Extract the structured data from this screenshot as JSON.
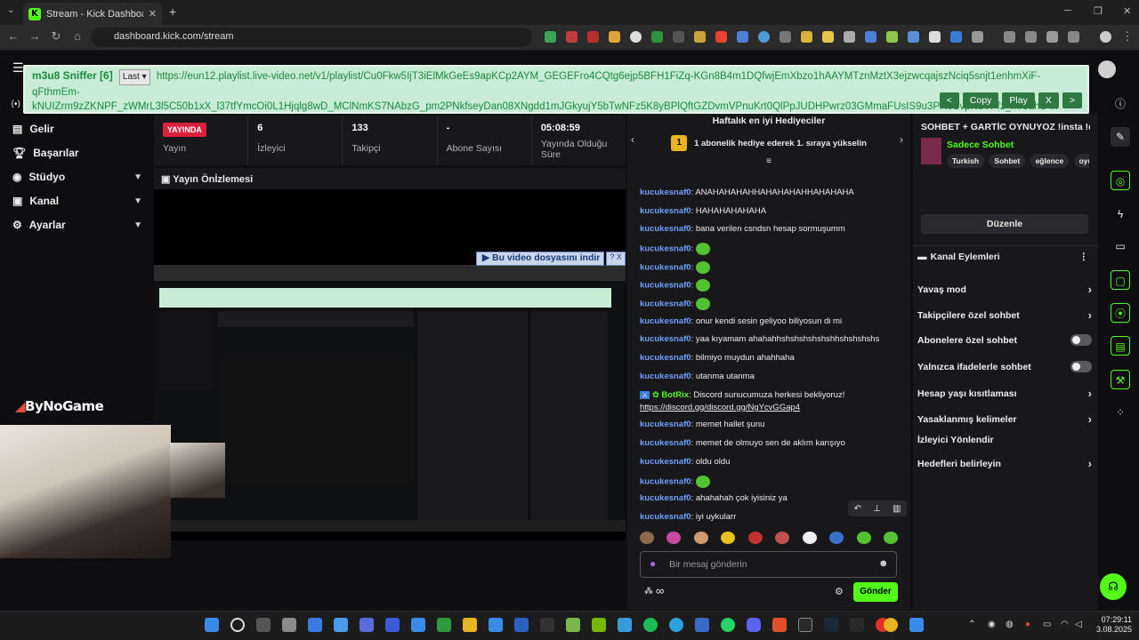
{
  "browser": {
    "tab_title": "Stream - Kick Dashboard",
    "url": "dashboard.kick.com/stream",
    "new_tab_symbol": "+"
  },
  "sniffer": {
    "title": "m3u8 Sniffer [6]",
    "last_label": "Last",
    "url": "https://eun12.playlist.live-video.net/v1/playlist/Cu0Fkw5IjT3iElMkGeEs9apKCp2AYM_GEGEFro4CQtg6ejp5BFH1FiZq-KGn8B4m1DQfwjEmXbzo1hAAYMTznMztX3ejzwcqajszNciq5snjt1enhmXiF-qFthmEm-kNUIZrm9zZKNPF_zWMrL3l5C50b1xX_l37tfYmcOi0L1Hjqlg8wD_MClNmKS7NAbzG_pm2PNkfseyDan08XNgdd1mJGkyujY5bTwNFz5K8yBPlQftGZDvmVPnuKrt0QlPpJUDHPwrz03GMmaFUsIS9u3PR0SvpNuVPfz_mr8ahS ...",
    "buttons": [
      "<",
      "Copy",
      "Play",
      "X",
      ">"
    ]
  },
  "leftnav": {
    "items": [
      {
        "label": "Gelir",
        "icon": "income-icon",
        "chevron": false
      },
      {
        "label": "Başarılar",
        "icon": "trophy-icon",
        "chevron": false
      },
      {
        "label": "Stüdyo",
        "icon": "studio-icon",
        "chevron": true
      },
      {
        "label": "Kanal",
        "icon": "channel-icon",
        "chevron": true
      },
      {
        "label": "Ayarlar",
        "icon": "gear-icon",
        "chevron": true
      }
    ]
  },
  "stats": {
    "live_badge": "YAYINDA",
    "live_label": "Yayın",
    "viewers_value": "6",
    "viewers_label": "İzleyici",
    "followers_value": "133",
    "followers_label": "Takipçi",
    "subs_value": "-",
    "subs_label": "Abone Sayısı",
    "uptime_value": "05:08:59",
    "uptime_label": "Yayında Olduğu Süre"
  },
  "preview": {
    "title": "Yayın Önİzlemesi",
    "download_label": "Bu video dosyasını indir",
    "download_close": "? X",
    "logo_text": "ByNoGame"
  },
  "chat": {
    "gifters_title": "Haftalık en iyi Hediyeciler",
    "gift_rank": "1",
    "gift_text": "1 abonelik hediye ederek 1. sıraya yükselin",
    "messages": [
      {
        "user": "kucukesnaf0",
        "text": "ANAHAHAHAHHAHAHAHAHHAHAHAHA",
        "emote": false
      },
      {
        "user": "kucukesnaf0",
        "text": "HAHAHAHAHAHA",
        "emote": false
      },
      {
        "user": "kucukesnaf0",
        "text": "bana verilen csndsn hesap sormuşumm",
        "emote": false
      },
      {
        "user": "kucukesnaf0",
        "text": "",
        "emote": true
      },
      {
        "user": "kucukesnaf0",
        "text": "",
        "emote": true
      },
      {
        "user": "kucukesnaf0",
        "text": "",
        "emote": true
      },
      {
        "user": "kucukesnaf0",
        "text": "",
        "emote": true
      },
      {
        "user": "kucukesnaf0",
        "text": "onur kendi sesin geliyoo biliyosun di mi",
        "emote": false
      },
      {
        "user": "kucukesnaf0",
        "text": "yaa kıyamam ahahahhshshshshshshhshshshshs",
        "emote": false
      },
      {
        "user": "kucukesnaf0",
        "text": "bilmiyo muydun ahahhaha",
        "emote": false
      },
      {
        "user": "kucukesnaf0",
        "text": "utanma utanma",
        "emote": false
      }
    ],
    "bot_user": "BotRix",
    "bot_text": "Discord sunucumuza herkesi bekliyoruz!",
    "bot_link": "https://discord.gg/discord.gg/NgYcvGGap4",
    "messages2": [
      {
        "user": "kucukesnaf0",
        "text": "memet hallet şunu",
        "emote": false
      },
      {
        "user": "kucukesnaf0",
        "text": "memet de olmuyo sen de aklım karışıyo",
        "emote": false
      },
      {
        "user": "kucukesnaf0",
        "text": "oldu oldu",
        "emote": false
      },
      {
        "user": "kucukesnaf0",
        "text": "",
        "emote": true
      },
      {
        "user": "kucukesnaf0",
        "text": "ahahahah çok iyisiniz ya",
        "emote": false
      },
      {
        "user": "kucukesnaf0",
        "text": "iyi uykularr",
        "emote": false
      }
    ],
    "input_placeholder": "Bir mesaj gönderin",
    "send_label": "Gönder",
    "infinity": "∞"
  },
  "rightpanel": {
    "stream_title": "SOHBET + GARTİC OYNUYOZ !insta !dc",
    "category": "Sadece Sohbet",
    "tags": [
      "Turkish",
      "Sohbet",
      "eğlence",
      "oyun"
    ],
    "edit_label": "Düzenle",
    "actions_title": "Kanal Eylemleri",
    "actions": [
      {
        "label": "Yavaş mod",
        "kind": "chevron"
      },
      {
        "label": "Takipçilere özel sohbet",
        "kind": "chevron"
      },
      {
        "label": "Abonelere özel sohbet",
        "kind": "toggle"
      },
      {
        "label": "Yalnızca ifadelerle sohbet",
        "kind": "toggle"
      },
      {
        "label": "Hesap yaşı kısıtlaması",
        "kind": "chevron"
      },
      {
        "label": "Yasaklanmış kelimeler",
        "kind": "chevron"
      },
      {
        "label": "İzleyici Yönlendir",
        "kind": "none"
      },
      {
        "label": "Hedefleri belirleyin",
        "kind": "chevron"
      }
    ]
  },
  "taskbar": {
    "time": "07:29:11",
    "date": "3.08.2025"
  },
  "colors": {
    "kick_green": "#53fc18",
    "live_red": "#d9213c",
    "username_blue": "#6ea0ff"
  }
}
